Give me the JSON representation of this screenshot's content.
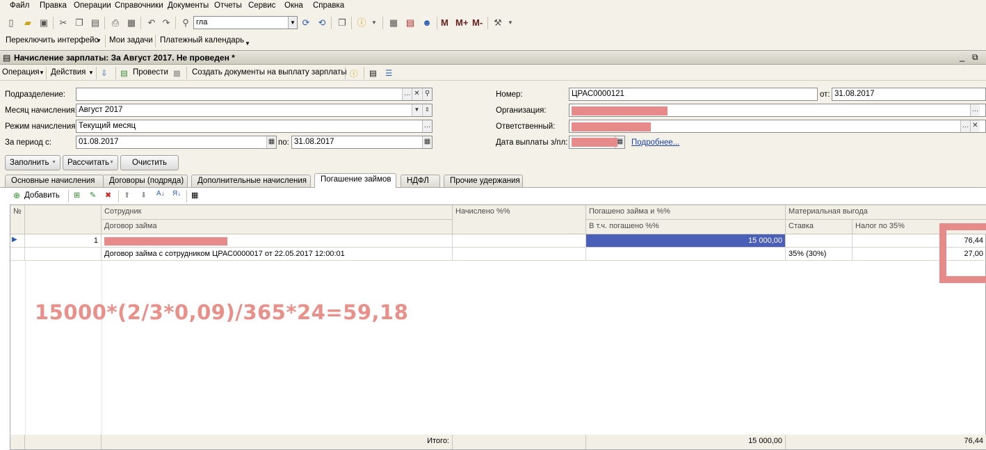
{
  "menu": [
    "Файл",
    "Правка",
    "Операции",
    "Справочники",
    "Документы",
    "Отчеты",
    "Сервис",
    "Окна",
    "Справка"
  ],
  "search": {
    "value": "гла"
  },
  "memory": {
    "m": "M",
    "mplus": "M+",
    "mminus": "M-"
  },
  "panel": {
    "switch": "Переключить интерфейс",
    "tasks": "Мои задачи",
    "calendar": "Платежный календарь"
  },
  "window": {
    "title": "Начисление зарплаты: За Август 2017. Не проведен *"
  },
  "doc_toolbar": {
    "operation": "Операция",
    "actions": "Действия",
    "post": "Провести",
    "create_docs": "Создать документы на выплату зарплаты"
  },
  "form": {
    "division_label": "Подразделение:",
    "division_value": "",
    "month_label": "Месяц начисления:",
    "month_value": "Август 2017",
    "mode_label": "Режим начисления:",
    "mode_value": "Текущий месяц",
    "period_label": "За период с:",
    "period_from": "01.08.2017",
    "period_to_label": "по:",
    "period_to": "31.08.2017",
    "number_label": "Номер:",
    "number_value": "ЦРАС0000121",
    "date_label": "от:",
    "date_value": "31.08.2017",
    "org_label": "Организация:",
    "resp_label": "Ответственный:",
    "paydate_label": "Дата выплаты з/пл:",
    "more_link": "Подробнее..."
  },
  "buttons": {
    "fill": "Заполнить",
    "calc": "Рассчитать",
    "clear": "Очистить"
  },
  "tabs": [
    "Основные начисления",
    "Договоры (подряда)",
    "Дополнительные начисления",
    "Погашение займов",
    "НДФЛ",
    "Прочие удержания"
  ],
  "grid_toolbar": {
    "add": "Добавить"
  },
  "grid": {
    "headers": {
      "num": "№",
      "employee": "Сотрудник",
      "contract": "Договор займа",
      "accrued": "Начислено %%",
      "repaid": "Погашено займа и %%",
      "incl_repaid": "В т.ч. погашено %%",
      "material": "Материальная выгода",
      "rate": "Ставка",
      "tax": "Налог по 35%"
    },
    "rows": [
      {
        "num": "1",
        "contract": "Договор займа с сотрудником ЦРАС0000017 от 22.05.2017 12:00:01",
        "repaid": "15 000,00",
        "rate": "35% (30%)",
        "benefit": "76,44",
        "tax": "27,00"
      }
    ],
    "totals": {
      "label": "Итого:",
      "repaid": "15 000,00",
      "benefit": "76,44"
    }
  },
  "annotation": "15000*(2/3*0,09)/365*24=59,18",
  "colors": {
    "redaction": "#e68a8a",
    "selection": "#4a5fb8"
  }
}
